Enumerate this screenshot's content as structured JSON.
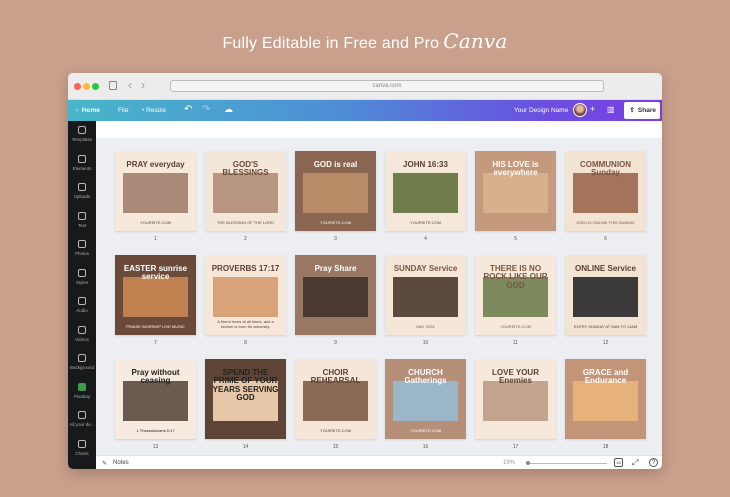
{
  "headline": {
    "text": "Fully Editable in Free and Pro",
    "brand": "Canva"
  },
  "browser": {
    "url": "canva.com"
  },
  "toolbar": {
    "home": "Home",
    "file": "File",
    "resize": "Resize",
    "design_name": "Your Design Name",
    "share": "Share"
  },
  "sidebar": [
    {
      "label": "Templates"
    },
    {
      "label": "Elements"
    },
    {
      "label": "Uploads"
    },
    {
      "label": "Text"
    },
    {
      "label": "Photos"
    },
    {
      "label": "Styles"
    },
    {
      "label": "Audio"
    },
    {
      "label": "Videos"
    },
    {
      "label": "Background"
    },
    {
      "label": "Pixabay"
    },
    {
      "label": "All your de..."
    },
    {
      "label": "Charts"
    }
  ],
  "pages": [
    {
      "num": "1",
      "title": "PRAY everyday",
      "sub": "YOURSITE.COM",
      "bg": "#f6e9dc",
      "fg": "#5a4033",
      "photo": "#a98a78"
    },
    {
      "num": "2",
      "title": "GOD'S BLESSINGS",
      "sub": "THE BLESSING OF THE LORD",
      "bg": "#f4e6d8",
      "fg": "#6b4a37",
      "photo": "#b89580"
    },
    {
      "num": "3",
      "title": "GOD is real",
      "sub": "YOURSITE.COM",
      "bg": "#8a6550",
      "fg": "#fff",
      "photo": "#b88c66"
    },
    {
      "num": "4",
      "title": "JOHN 16:33",
      "sub": "YOURSITE.COM",
      "bg": "#f5e8da",
      "fg": "#5a4033",
      "photo": "#6f7d4d"
    },
    {
      "num": "5",
      "title": "HIS LOVE is everywhere",
      "sub": "",
      "bg": "#c59a7c",
      "fg": "#fff",
      "photo": "#d7b08c"
    },
    {
      "num": "6",
      "title": "COMMUNION Sunday",
      "sub": "JOIN US ONLINE THIS SUNDAY",
      "bg": "#f3e3d3",
      "fg": "#7a5540",
      "photo": "#a5735a"
    },
    {
      "num": "7",
      "title": "EASTER sunrise service",
      "sub": "PRAISE WORSHIP LIVE MUSIC",
      "bg": "#6b4a3a",
      "fg": "#fff",
      "photo": "#c08050"
    },
    {
      "num": "8",
      "title": "PROVERBS 17:17",
      "sub": "A friend loves at all times, and a brother is born for adversity.",
      "bg": "#f6e7d8",
      "fg": "#5a4033",
      "photo": "#d9a37a"
    },
    {
      "num": "9",
      "title": "Pray Share",
      "sub": "",
      "bg": "#9a7763",
      "fg": "#fff",
      "photo": "#4a3a33"
    },
    {
      "num": "10",
      "title": "SUNDAY Service",
      "sub": "MAY 2024",
      "bg": "#f5e6d7",
      "fg": "#7a5540",
      "photo": "#5c4a3f"
    },
    {
      "num": "11",
      "title": "THERE IS NO ROCK LIKE OUR GOD",
      "sub": "YOURSITE.COM",
      "bg": "#f6e9dc",
      "fg": "#7a5540",
      "photo": "#7d8a5e"
    },
    {
      "num": "12",
      "title": "ONLINE Service",
      "sub": "EVERY SUNDAY AT 9AM TO 11AM",
      "bg": "#f3e3d3",
      "fg": "#5a4033",
      "photo": "#3a3a3a"
    },
    {
      "num": "13",
      "title": "Pray without ceasing",
      "sub": "1 Thessalonians 5:17",
      "bg": "#f7ebe0",
      "fg": "#222",
      "photo": "#6b5a4e"
    },
    {
      "num": "14",
      "title": "SPEND THE PRIME OF YOUR YEARS SERVING GOD",
      "sub": "",
      "bg": "#5e4536",
      "fg": "#222",
      "photo": "#e6c8a8"
    },
    {
      "num": "15",
      "title": "CHOIR REHEARSAL",
      "sub": "YOURSITE.COM",
      "bg": "#f5e6d7",
      "fg": "#5a4033",
      "photo": "#8a6a55"
    },
    {
      "num": "16",
      "title": "CHURCH Gatherings",
      "sub": "YOURSITE.COM",
      "bg": "#b68f78",
      "fg": "#fff",
      "photo": "#9cb6c9"
    },
    {
      "num": "17",
      "title": "LOVE YOUR Enemies",
      "sub": "",
      "bg": "#f6e9dc",
      "fg": "#5a4033",
      "photo": "#c4a48e"
    },
    {
      "num": "18",
      "title": "GRACE and Endurance",
      "sub": "",
      "bg": "#c29478",
      "fg": "#fff",
      "photo": "#e6b27a"
    }
  ],
  "bottom": {
    "notes": "Notes",
    "zoom": "19%"
  }
}
